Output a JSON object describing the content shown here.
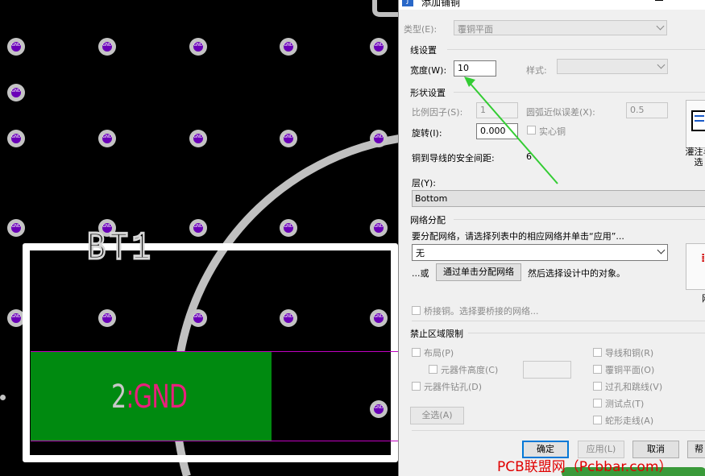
{
  "window": {
    "title": "添加铺铜"
  },
  "canvas": {
    "via_label": "GND",
    "ref_designator": "BT1",
    "pad_number": "2",
    "pad_net": "GND",
    "pad_separator": ":"
  },
  "dialog": {
    "type_label": "类型(E):",
    "type_value": "覆铜平面",
    "line_group": "线设置",
    "width_label": "宽度(W):",
    "width_value": "10",
    "style_label": "样式:",
    "shape_group": "形状设置",
    "scale_label": "比例因子(S):",
    "scale_value": "1",
    "arc_err_label": "圆弧近似误差(X):",
    "arc_err_value": "0.5",
    "rotate_label": "旋转(I):",
    "rotate_value": "0.000",
    "solid_label": "实心铜",
    "clearance_label": "铜到导线的安全间距:",
    "clearance_value": "6",
    "fill_button_label": "灌注与\n选",
    "layer_label": "层(Y):",
    "layer_value": "Bottom",
    "net_group": "网络分配",
    "net_instruction": "要分配网络，请选择列表中的相应网络并单击“应用”...",
    "net_value": "无",
    "or_label": "...或",
    "assign_click_button": "通过单击分配网络",
    "assign_after": "然后选择设计中的对象。",
    "net_right_button_label": "网",
    "bridge_label": "桥接铜。选择要桥接的网络...",
    "keepout_group": "禁止区域限制",
    "ko_layout": "布局(P)",
    "ko_comp_height": "元器件高度(C)",
    "ko_drill": "元器件钻孔(D)",
    "ko_select_all": "全选(A)",
    "ko_traces": "导线和铜(R)",
    "ko_plane": "覆铜平面(O)",
    "ko_vias": "过孔和跳线(V)",
    "ko_testpoints": "测试点(T)",
    "ko_serpentine": "蛇形走线(A)",
    "ok_button": "确定",
    "apply_button": "应用(L)",
    "cancel_button": "取消",
    "help_button": "帮"
  },
  "watermark": "PCB联盟网（Pcbbar.com）",
  "colors": {
    "accent": "#0078d7",
    "arrow": "#33cc33",
    "pad": "#008a10",
    "net": "#e8207c"
  }
}
